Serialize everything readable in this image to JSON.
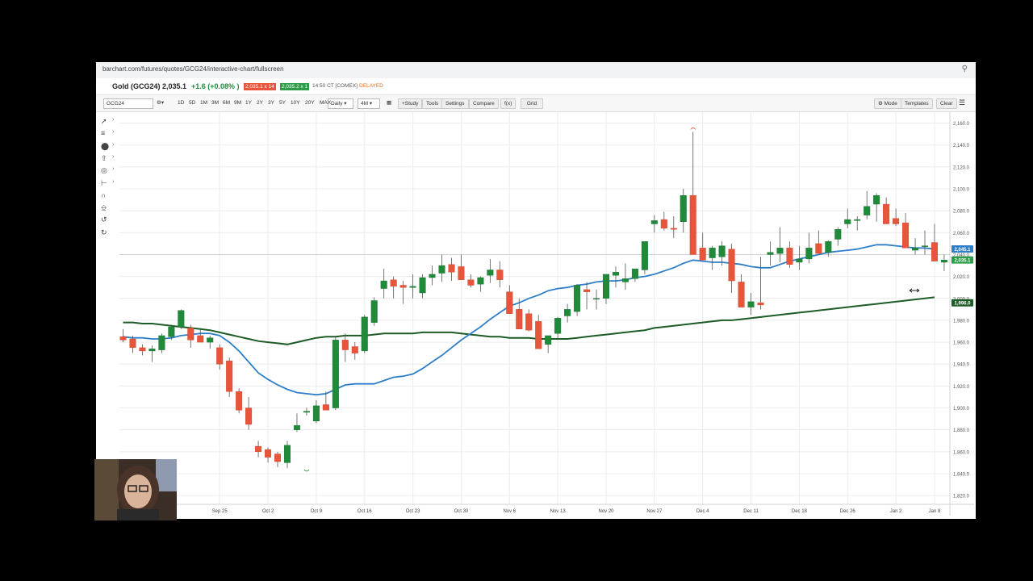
{
  "browser": {
    "url": "barchart.com/futures/quotes/GCG24/interactive-chart/fullscreen"
  },
  "quote": {
    "symbol_name": "Gold (GCG24)",
    "last": "2,035.1",
    "change": "+1.6 (+0.08% )",
    "bid": "2,035.1 x 14",
    "ask": "2,035.2 x 1",
    "time_exchange": "14:50 CT [COMEX]",
    "status": "DELAYED"
  },
  "toolbar": {
    "symbol_value": "GCG24",
    "ranges": [
      "1D",
      "5D",
      "1M",
      "3M",
      "6M",
      "9M",
      "1Y",
      "2Y",
      "3Y",
      "5Y",
      "10Y",
      "20Y",
      "MAX"
    ],
    "interval": "Daily",
    "period": "4M",
    "study_label": "+Study",
    "tools_label": "Tools",
    "settings_label": "Settings",
    "compare_label": "Compare",
    "fx_label": "f(x)",
    "grid_label": "Grid",
    "mode_label": "Mode",
    "templates_label": "Templates",
    "clear_label": "Clear"
  },
  "drawing_tools": [
    "trendline-icon",
    "fibonacci-icon",
    "shape-icon",
    "arrow-icon",
    "target-icon",
    "measure-icon",
    "magnet-icon",
    "lock-icon",
    "undo-icon",
    "redo-icon"
  ],
  "colors": {
    "up": "#1f8a3a",
    "down": "#e8553a",
    "ma_short": "#2f7ec9",
    "ma_long": "#1d5c26",
    "last_badge": "#2d9b48"
  },
  "chart_data": {
    "type": "candlestick",
    "ylim": [
      1812,
      2170
    ],
    "ytick_labels": [
      "2,160.0",
      "2,140.0",
      "2,120.0",
      "2,100.0",
      "2,080.0",
      "2,060.0",
      "2,040.0",
      "2,020.0",
      "2,000.0",
      "1,980.0",
      "1,960.0",
      "1,940.0",
      "1,920.0",
      "1,900.0",
      "1,880.0",
      "1,860.0",
      "1,840.0",
      "1,820.0"
    ],
    "ytick_values": [
      2160,
      2140,
      2120,
      2100,
      2080,
      2060,
      2040,
      2020,
      2000,
      1980,
      1960,
      1940,
      1920,
      1900,
      1880,
      1860,
      1840,
      1820
    ],
    "xtick_labels": [
      "Sep 25",
      "Oct 2",
      "Oct 9",
      "Oct 16",
      "Oct 23",
      "Oct 30",
      "Nov 6",
      "Nov 13",
      "Nov 20",
      "Nov 27",
      "Dec 4",
      "Dec 11",
      "Dec 18",
      "Dec 26",
      "Jan 2",
      "Jan 8"
    ],
    "xtick_index": [
      10,
      15,
      20,
      25,
      30,
      35,
      40,
      45,
      50,
      55,
      60,
      65,
      70,
      75,
      80,
      84
    ],
    "candles": [
      [
        1965,
        1972,
        1960,
        1962
      ],
      [
        1963,
        1966,
        1950,
        1955
      ],
      [
        1955,
        1958,
        1948,
        1952
      ],
      [
        1952,
        1957,
        1942,
        1954
      ],
      [
        1953,
        1968,
        1950,
        1966
      ],
      [
        1965,
        1976,
        1962,
        1974
      ],
      [
        1974,
        1990,
        1972,
        1989
      ],
      [
        1973,
        1976,
        1955,
        1962
      ],
      [
        1966,
        1972,
        1960,
        1960
      ],
      [
        1960,
        1966,
        1954,
        1964
      ],
      [
        1955,
        1958,
        1935,
        1940
      ],
      [
        1943,
        1946,
        1910,
        1915
      ],
      [
        1915,
        1918,
        1895,
        1898
      ],
      [
        1900,
        1910,
        1880,
        1885
      ],
      [
        1865,
        1870,
        1855,
        1860
      ],
      [
        1862,
        1864,
        1850,
        1855
      ],
      [
        1858,
        1860,
        1846,
        1851
      ],
      [
        1850,
        1870,
        1845,
        1866
      ],
      [
        1880,
        1895,
        1878,
        1884
      ],
      [
        1896,
        1900,
        1893,
        1897
      ],
      [
        1888,
        1907,
        1886,
        1902
      ],
      [
        1903,
        1915,
        1900,
        1898
      ],
      [
        1900,
        1965,
        1898,
        1962
      ],
      [
        1962,
        1968,
        1942,
        1953
      ],
      [
        1956,
        1960,
        1944,
        1950
      ],
      [
        1952,
        1985,
        1950,
        1983
      ],
      [
        1978,
        2001,
        1975,
        1998
      ],
      [
        2009,
        2027,
        2000,
        2016
      ],
      [
        2017,
        2020,
        2000,
        2011
      ],
      [
        2012,
        2016,
        1995,
        2010
      ],
      [
        2010,
        2022,
        2000,
        2011
      ],
      [
        2005,
        2022,
        2000,
        2019
      ],
      [
        2019,
        2030,
        2012,
        2022
      ],
      [
        2023,
        2040,
        2015,
        2030
      ],
      [
        2031,
        2037,
        2016,
        2024
      ],
      [
        2029,
        2040,
        2020,
        2017
      ],
      [
        2017,
        2022,
        2010,
        2012
      ],
      [
        2013,
        2020,
        2006,
        2019
      ],
      [
        2021,
        2036,
        2014,
        2026
      ],
      [
        2026,
        2034,
        2010,
        2017
      ],
      [
        2006,
        2012,
        1992,
        1986
      ],
      [
        1990,
        2000,
        1982,
        1972
      ],
      [
        1986,
        1990,
        1970,
        1971
      ],
      [
        1979,
        1985,
        1958,
        1954
      ],
      [
        1958,
        1965,
        1950,
        1966
      ],
      [
        1968,
        1983,
        1962,
        1982
      ],
      [
        1984,
        1995,
        1978,
        1990
      ],
      [
        1988,
        2013,
        1984,
        2012
      ],
      [
        2008,
        2015,
        1990,
        2006
      ],
      [
        2000,
        2008,
        1990,
        2000
      ],
      [
        2000,
        2020,
        1995,
        2022
      ],
      [
        2021,
        2029,
        2010,
        2024
      ],
      [
        2015,
        2032,
        2008,
        2018
      ],
      [
        2018,
        2027,
        2015,
        2027
      ],
      [
        2026,
        2048,
        2022,
        2052
      ],
      [
        2068,
        2076,
        2060,
        2071
      ],
      [
        2072,
        2079,
        2062,
        2064
      ],
      [
        2064,
        2075,
        2055,
        2063
      ],
      [
        2070,
        2100,
        2060,
        2094
      ],
      [
        2094,
        2152,
        2045,
        2040
      ],
      [
        2046,
        2060,
        2035,
        2035
      ],
      [
        2037,
        2048,
        2026,
        2046
      ],
      [
        2038,
        2052,
        2030,
        2048
      ],
      [
        2045,
        2050,
        2005,
        2016
      ],
      [
        2015,
        2022,
        1993,
        1992
      ],
      [
        1992,
        2005,
        1985,
        1997
      ],
      [
        1996,
        2038,
        1990,
        1994
      ],
      [
        2040,
        2052,
        2030,
        2042
      ],
      [
        2041,
        2065,
        2033,
        2046
      ],
      [
        2046,
        2052,
        2028,
        2031
      ],
      [
        2033,
        2048,
        2026,
        2036
      ],
      [
        2036,
        2060,
        2032,
        2046
      ],
      [
        2050,
        2062,
        2043,
        2041
      ],
      [
        2042,
        2053,
        2038,
        2052
      ],
      [
        2054,
        2065,
        2048,
        2063
      ],
      [
        2068,
        2082,
        2064,
        2072
      ],
      [
        2071,
        2075,
        2062,
        2072
      ],
      [
        2076,
        2098,
        2072,
        2084
      ],
      [
        2086,
        2096,
        2070,
        2094
      ],
      [
        2086,
        2092,
        2072,
        2068
      ],
      [
        2073,
        2082,
        2066,
        2068
      ],
      [
        2069,
        2078,
        2060,
        2046
      ],
      [
        2044,
        2055,
        2040,
        2046
      ],
      [
        2048,
        2062,
        2040,
        2048
      ],
      [
        2051,
        2068,
        2036,
        2034
      ],
      [
        2033,
        2040,
        2025,
        2035
      ]
    ],
    "ma_short": [
      1965,
      1964,
      1964,
      1963,
      1963,
      1964,
      1966,
      1967,
      1968,
      1968,
      1966,
      1960,
      1952,
      1942,
      1932,
      1926,
      1921,
      1917,
      1914,
      1913,
      1912,
      1913,
      1917,
      1921,
      1922,
      1922,
      1922,
      1925,
      1928,
      1929,
      1931,
      1936,
      1942,
      1948,
      1955,
      1962,
      1968,
      1974,
      1981,
      1987,
      1993,
      1996,
      2000,
      2003,
      2007,
      2009,
      2010,
      2012,
      2013,
      2015,
      2016,
      2016,
      2017,
      2019,
      2020,
      2022,
      2025,
      2028,
      2032,
      2035,
      2034,
      2033,
      2033,
      2032,
      2031,
      2029,
      2028,
      2028,
      2031,
      2034,
      2036,
      2038,
      2040,
      2042,
      2043,
      2044,
      2045,
      2047,
      2049,
      2049,
      2048,
      2047,
      2046,
      2046,
      2045
    ],
    "ma_long": [
      1978,
      1978,
      1977,
      1977,
      1976,
      1975,
      1974,
      1973,
      1972,
      1971,
      1969,
      1967,
      1965,
      1963,
      1961,
      1960,
      1959,
      1958,
      1960,
      1962,
      1964,
      1965,
      1965,
      1966,
      1966,
      1966,
      1967,
      1968,
      1968,
      1968,
      1968,
      1969,
      1969,
      1969,
      1969,
      1968,
      1967,
      1966,
      1965,
      1965,
      1964,
      1964,
      1964,
      1963,
      1963,
      1963,
      1963,
      1964,
      1965,
      1966,
      1967,
      1968,
      1969,
      1970,
      1971,
      1973,
      1974,
      1975,
      1976,
      1977,
      1978,
      1979,
      1980,
      1980,
      1981,
      1982,
      1983,
      1984,
      1985,
      1986,
      1987,
      1988,
      1989,
      1990,
      1991,
      1992,
      1993,
      1994,
      1995,
      1996,
      1997,
      1998,
      1999,
      2000,
      2001
    ],
    "price_badges": [
      {
        "value": 2045.1,
        "label": "2,045.1",
        "color": "#2f7ec9"
      },
      {
        "value": 2035.1,
        "label": "2,035.1",
        "color": "#2d9b48"
      },
      {
        "value": 1996.0,
        "label": "1,996.0",
        "color": "#1d5c26"
      }
    ],
    "crosshair_y": 2040
  }
}
